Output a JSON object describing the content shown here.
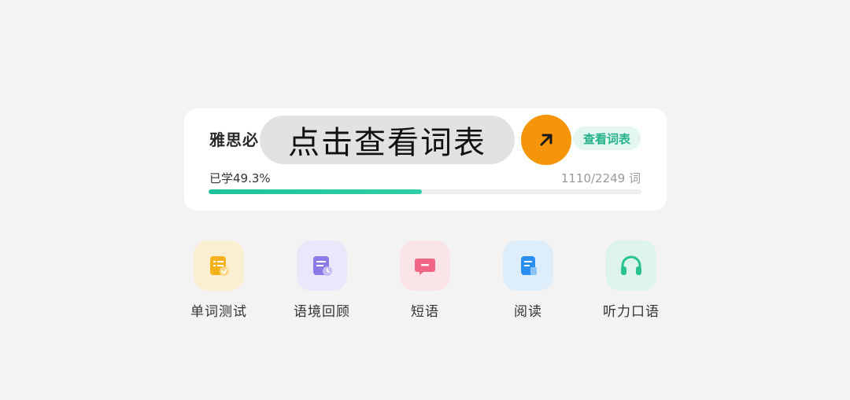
{
  "card": {
    "book_title": "雅思必",
    "tooltip": "点击查看词表",
    "view_button": "查看词表",
    "learned_label": "已学49.3%",
    "progress_percent": 49.3,
    "word_count": "1110/2249 词"
  },
  "features": [
    {
      "label": "单词测试",
      "icon": "word-test-icon",
      "tile_color": "#fbefd2",
      "icon_color": "#f5b21d"
    },
    {
      "label": "语境回顾",
      "icon": "context-review-icon",
      "tile_color": "#ebe7fa",
      "icon_color": "#8a7ae6"
    },
    {
      "label": "短语",
      "icon": "phrase-icon",
      "tile_color": "#fbe4e8",
      "icon_color": "#f06484"
    },
    {
      "label": "阅读",
      "icon": "reading-icon",
      "tile_color": "#ddeefa",
      "icon_color": "#2a8ef0"
    },
    {
      "label": "听力口语",
      "icon": "headphones-icon",
      "tile_color": "#dcf4ec",
      "icon_color": "#29c28f"
    }
  ],
  "colors": {
    "accent_green": "#25b28a",
    "arrow_orange": "#f5960a"
  }
}
